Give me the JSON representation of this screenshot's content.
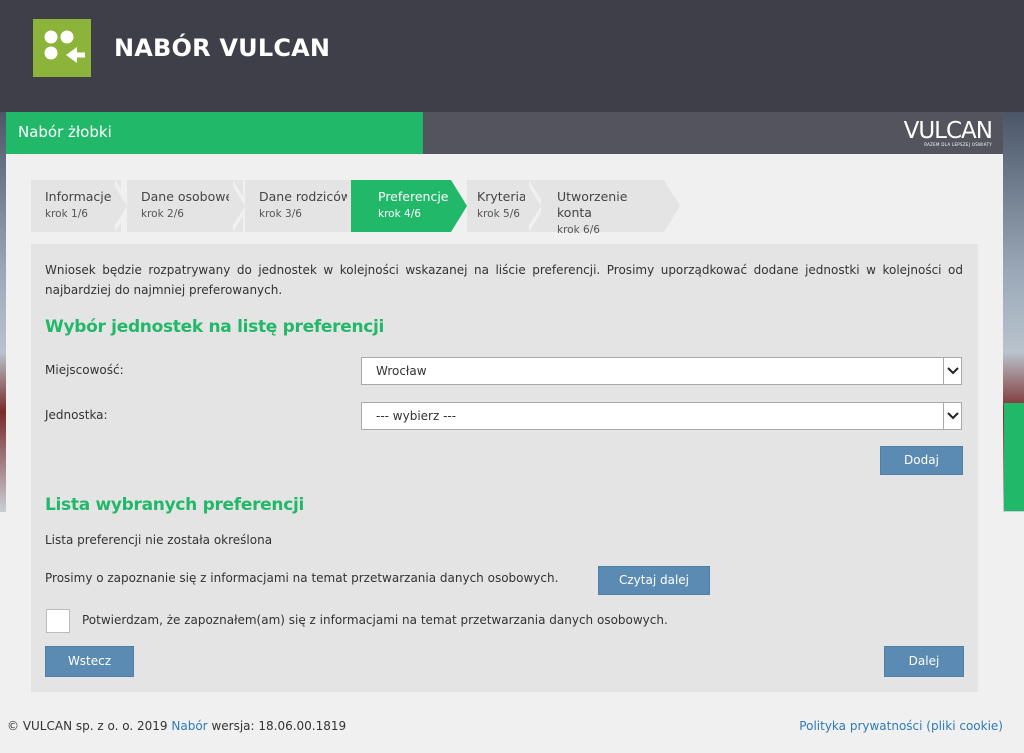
{
  "header": {
    "app_title": "NABÓR VULCAN",
    "logo_icon": "dots-arrow-logo-icon"
  },
  "module": {
    "title": "Nabór żłobki"
  },
  "brand": {
    "name": "VULCAN",
    "tagline": "RAZEM DLA LEPSZEJ OŚWIATY"
  },
  "steps": [
    {
      "label": "Informacje",
      "sub": "krok 1/6",
      "active": false
    },
    {
      "label": "Dane osobowe",
      "sub": "krok 2/6",
      "active": false
    },
    {
      "label": "Dane rodziców",
      "sub": "krok 3/6",
      "active": false
    },
    {
      "label": "Preferencje",
      "sub": "krok 4/6",
      "active": true
    },
    {
      "label": "Kryteria",
      "sub": "krok 5/6",
      "active": false
    },
    {
      "label": "Utworzenie konta",
      "sub": "krok 6/6",
      "active": false
    }
  ],
  "main": {
    "intro": "Wniosek będzie rozpatrywany do jednostek w kolejności wskazanej na liście preferencji. Prosimy uporządkować dodane jednostki w kolejności od najbardziej do najmniej preferowanych.",
    "selection_title": "Wybór jednostek na listę preferencji",
    "city_label": "Miejscowość:",
    "city_value": "Wrocław",
    "unit_label": "Jednostka:",
    "unit_value": "--- wybierz ---",
    "add_button": "Dodaj",
    "list_title": "Lista wybranych preferencji",
    "empty_list": "Lista preferencji nie została określona",
    "privacy_info": "Prosimy o zapoznanie się z informacjami na temat przetwarzania danych osobowych.",
    "read_more_button": "Czytaj dalej",
    "confirm_label": "Potwierdzam, że zapoznałem(am) się z informacjami na temat przetwarzania danych osobowych.",
    "back_button": "Wstecz",
    "next_button": "Dalej"
  },
  "footer": {
    "copyright": "© VULCAN sp. z o. o. 2019",
    "app_link": "Nabór",
    "version": "wersja: 18.06.00.1819",
    "privacy_link": "Polityka prywatności (pliki cookie)"
  },
  "colors": {
    "accent_green": "#22b86a",
    "header_dark": "#3f3f4a",
    "button_blue": "#5b8bb3",
    "logo_green": "#8db43a"
  }
}
